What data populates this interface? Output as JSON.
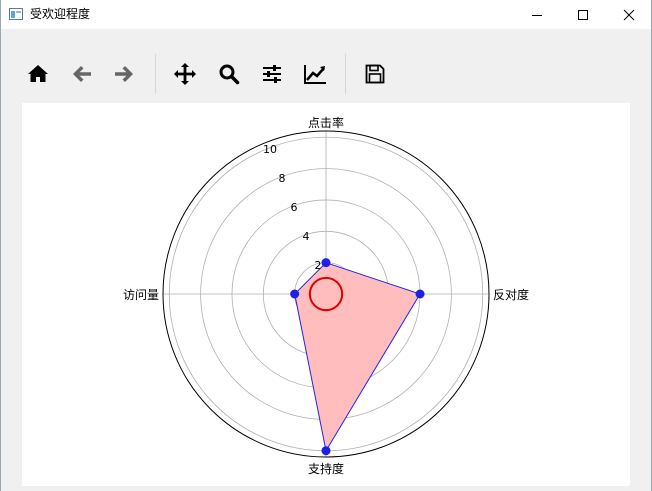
{
  "window": {
    "title": "受欢迎程度"
  },
  "toolbar": {
    "tools": [
      "home-icon",
      "back-arrow-icon",
      "forward-arrow-icon",
      "pan-icon",
      "zoom-icon",
      "configure-subplots-icon",
      "edit-axis-icon",
      "save-icon"
    ]
  },
  "chart_data": {
    "type": "radar",
    "title": "",
    "categories": [
      "点击率",
      "反对度",
      "支持度",
      "访问量"
    ],
    "series": [
      {
        "values": [
          2,
          6,
          10,
          2
        ],
        "line_color": "#2222ee",
        "fill_color": "#ffbdbd",
        "marker_color": "#1f1fe6"
      }
    ],
    "circle_marker": {
      "value": 1,
      "color": "#e00000"
    },
    "rlim": [
      0,
      10.4
    ],
    "r_ticks": [
      2,
      4,
      6,
      8,
      10
    ],
    "grid": true
  }
}
